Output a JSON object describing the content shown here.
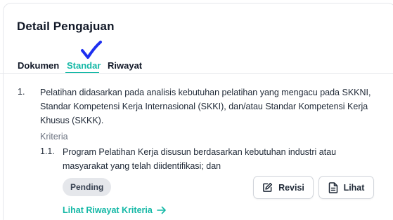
{
  "page_title": "Detail Pengajuan",
  "tabs": [
    {
      "label": "Dokumen",
      "active": false
    },
    {
      "label": "Standar",
      "active": true
    },
    {
      "label": "Riwayat",
      "active": false
    }
  ],
  "accent_color": "#14b8a6",
  "standard": {
    "number": "1.",
    "text": "Pelatihan didasarkan pada analisis kebutuhan pelatihan yang mengacu pada SKKNI, Standar Kompetensi Kerja Internasional (SKKI), dan/atau Standar Kompetensi Kerja Khusus (SKKK).",
    "criteria_label": "Kriteria",
    "criteria": [
      {
        "number": "1.1.",
        "text": "Program Pelatihan Kerja disusun berdasarkan kebutuhan industri atau masyarakat yang telah diidentifikasi; dan",
        "status": "Pending",
        "actions": {
          "revisi_label": "Revisi",
          "revisi_icon": "edit-icon",
          "lihat_label": "Lihat",
          "lihat_icon": "document-icon"
        }
      }
    ],
    "history_link": "Lihat Riwayat Kriteria",
    "history_icon": "arrow-right-icon"
  }
}
